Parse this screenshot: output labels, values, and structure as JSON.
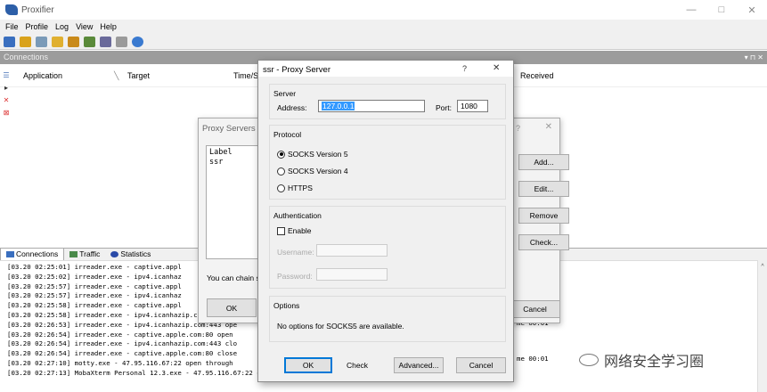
{
  "app": {
    "title": "Proxifier",
    "win_min": "—",
    "win_max": "□",
    "win_close": "✕"
  },
  "menu": [
    "File",
    "Profile",
    "Log",
    "View",
    "Help"
  ],
  "panel": {
    "title": "Connections",
    "pin": "▾ ⊓ ✕"
  },
  "columns": {
    "application": "Application",
    "target": "Target",
    "time": "Time/Sta",
    "received": "Received"
  },
  "tabs": [
    {
      "label": "Connections"
    },
    {
      "label": "Traffic"
    },
    {
      "label": "Statistics"
    }
  ],
  "log": [
    "[03.20 02:25:01] irreader.exe - captive.appl",
    "[03.20 02:25:02] irreader.exe - ipv4.icanhaz",
    "[03.20 02:25:57] irreader.exe - captive.appl",
    "[03.20 02:25:57] irreader.exe - ipv4.icanhaz",
    "[03.20 02:25:58] irreader.exe - captive.appl",
    "[03.20 02:25:58] irreader.exe - ipv4.icanhazip.com:443 clo",
    "[03.20 02:26:53] irreader.exe - ipv4.icanhazip.com:443 ope",
    "[03.20 02:26:54] irreader.exe - captive.apple.com:80 open",
    "[03.20 02:26:54] irreader.exe - ipv4.icanhazip.com:443 clo",
    "[03.20 02:26:54] irreader.exe - captive.apple.com:80 close",
    "[03.20 02:27:10] motty.exe - 47.95.116.67:22 open through",
    "[03.20 02:27:13] MobaXterm Personal 12.3.exe - 47.95.116.67:22 open through proxy ssr SOCKS5"
  ],
  "log_right": [
    "me 00:01",
    "me 00:01"
  ],
  "proxy_servers": {
    "title": "Proxy Servers",
    "help": "?",
    "close": "✕",
    "list_header": "Label",
    "list_item": "ssr",
    "chain_text": "You can chain s",
    "ok": "OK",
    "buttons": {
      "add": "Add...",
      "edit": "Edit...",
      "remove": "Remove",
      "check": "Check...",
      "cancel": "Cancel"
    }
  },
  "proxy_server": {
    "title": "ssr - Proxy Server",
    "help": "?",
    "close": "✕",
    "server_group": "Server",
    "address_label": "Address:",
    "address_value": "127.0.0.1",
    "port_label": "Port:",
    "port_value": "1080",
    "protocol_group": "Protocol",
    "socks5": "SOCKS Version 5",
    "socks4": "SOCKS Version 4",
    "https": "HTTPS",
    "auth_group": "Authentication",
    "enable": "Enable",
    "username": "Username:",
    "password": "Password:",
    "options_group": "Options",
    "options_text": "No options for SOCKS5 are available.",
    "ok": "OK",
    "check": "Check",
    "advanced": "Advanced...",
    "cancel": "Cancel"
  },
  "watermark": "网络安全学习圈"
}
